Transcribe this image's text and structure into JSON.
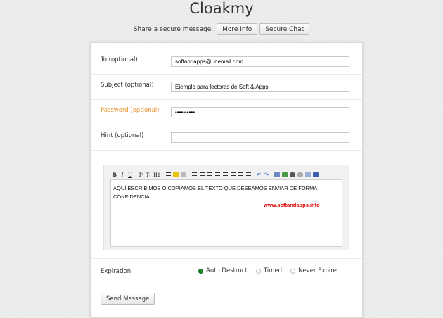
{
  "app": {
    "title": "Cloakmy"
  },
  "header": {
    "tagline": "Share a secure message.",
    "more_info_label": "More Info",
    "secure_chat_label": "Secure Chat"
  },
  "form": {
    "to": {
      "label": "To (optional)",
      "value": "softandapps@unemail.com"
    },
    "subject": {
      "label": "Subject (optional)",
      "value": "Ejemplo para lectores de Soft & Apps"
    },
    "password": {
      "label": "Password (optional)",
      "value": "••••••••••"
    },
    "hint": {
      "label": "Hint (optional)",
      "value": ""
    },
    "editor": {
      "text": "AQUÍ ESCRIBIMOS O COPIAMOS EL TEXTO QUE DESEAMOS ENVIAR DE FORMA CONFIDENCIAL.",
      "link": "www.softandapps.info",
      "toolbar": {
        "bold": "B",
        "italic": "I",
        "underline": "U",
        "superscript": "Tˢ",
        "subscript": "Tₓ",
        "header": "H1"
      }
    },
    "expiration": {
      "label": "Expiration",
      "options": [
        {
          "label": "Auto Destruct",
          "selected": true
        },
        {
          "label": "Timed",
          "selected": false
        },
        {
          "label": "Never Expire",
          "selected": false
        }
      ]
    },
    "send_label": "Send Message"
  },
  "colors": {
    "password_label": "#e8902b",
    "editor_link": "#e00000",
    "radio_selected": "#1e8a1e"
  }
}
